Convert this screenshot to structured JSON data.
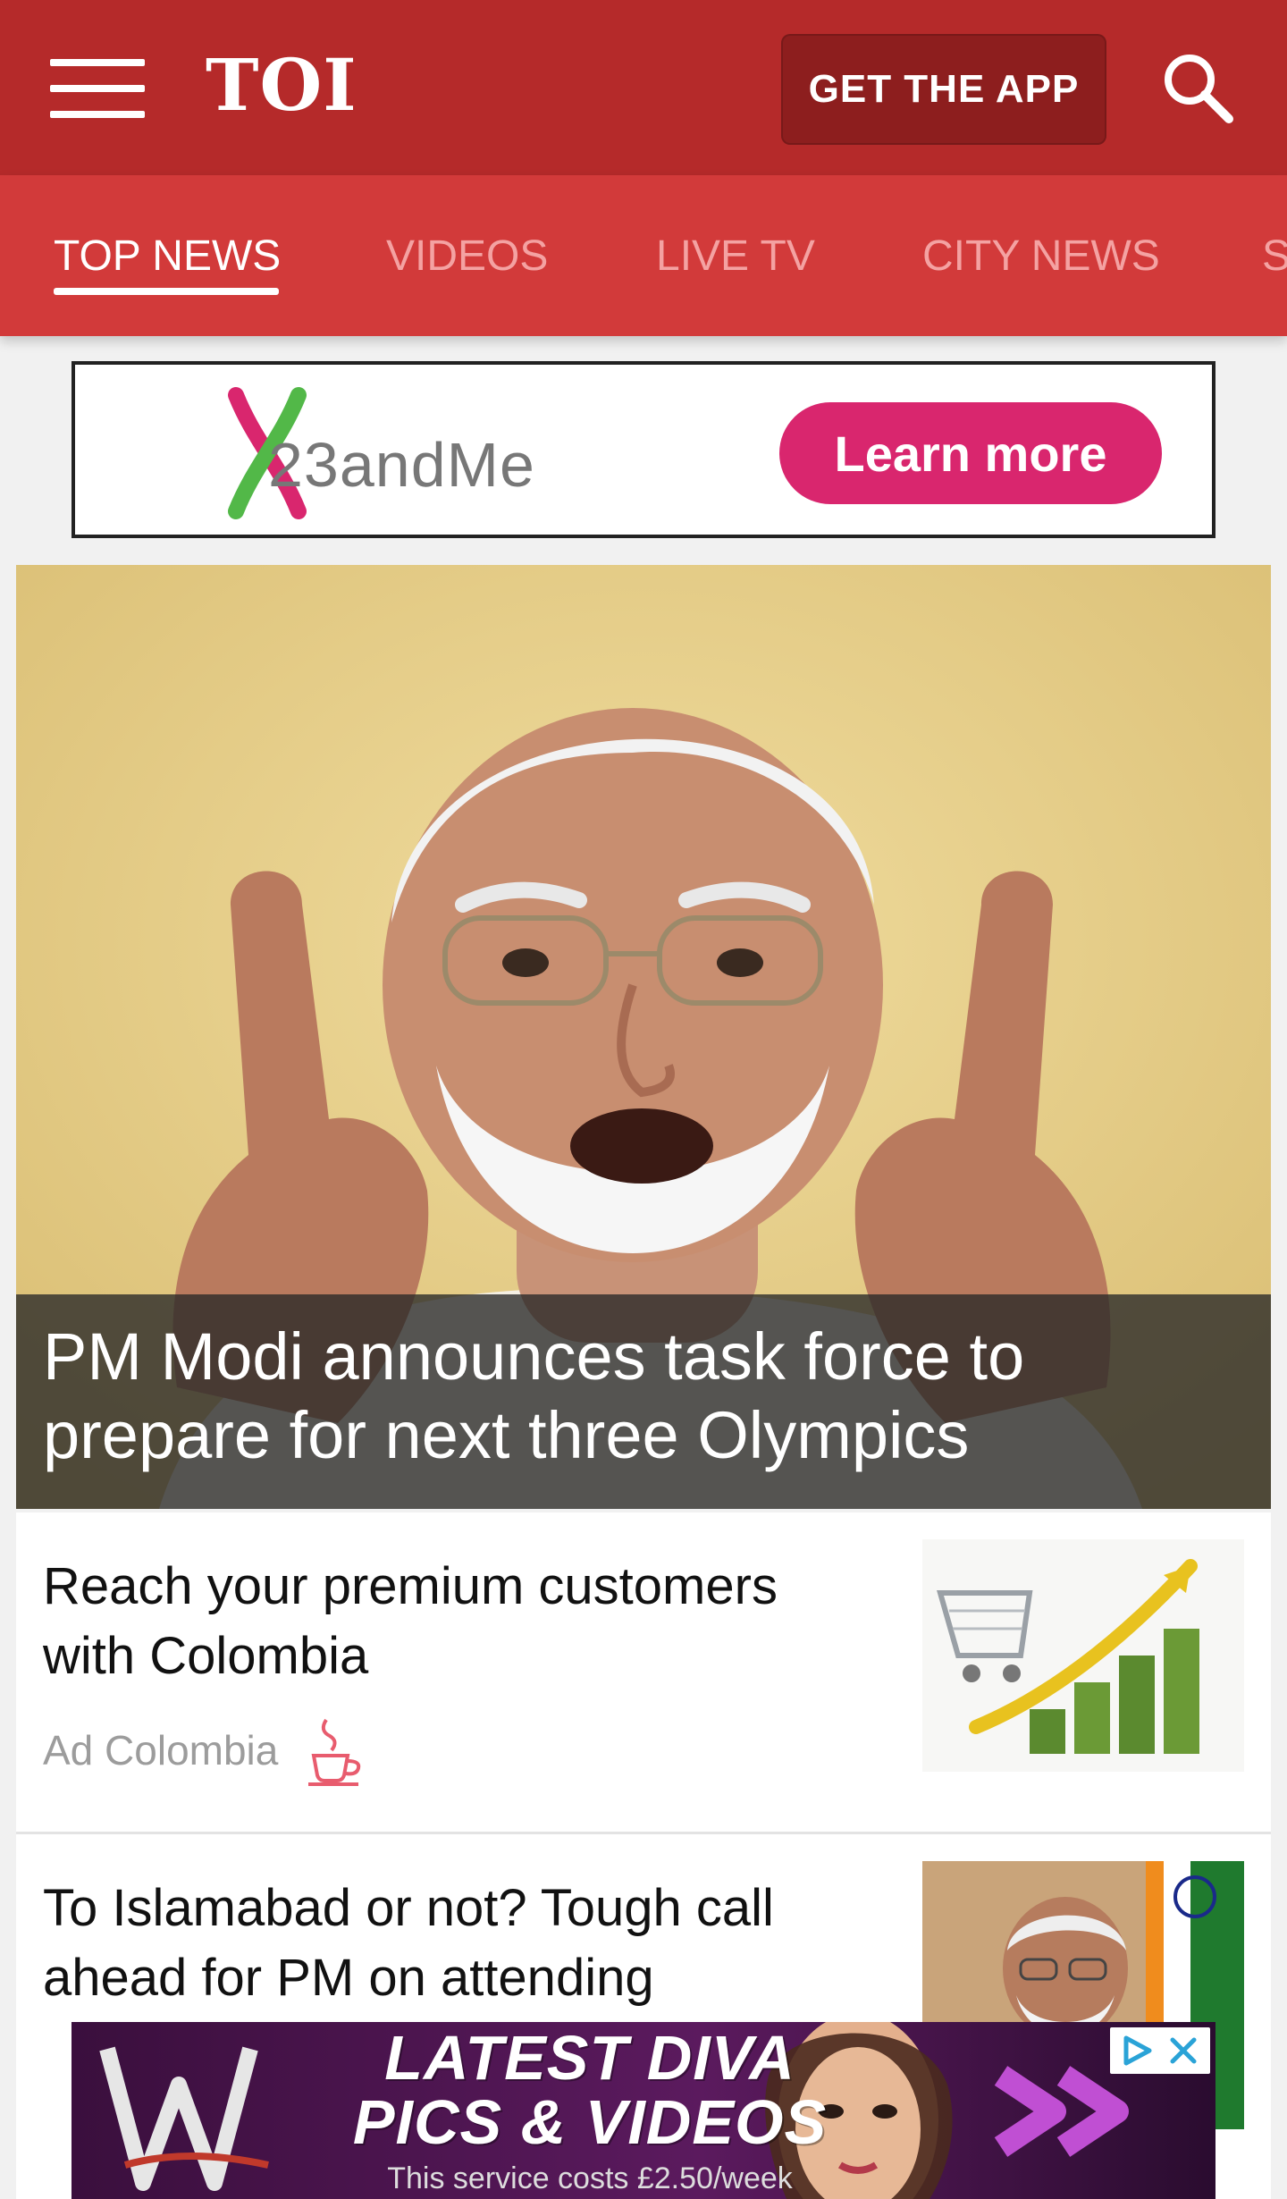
{
  "header": {
    "brand": "TOI",
    "get_app_label": "GET THE APP"
  },
  "nav": {
    "items": [
      {
        "label": "TOP NEWS",
        "active": true
      },
      {
        "label": "VIDEOS",
        "active": false
      },
      {
        "label": "LIVE TV",
        "active": false
      },
      {
        "label": "CITY NEWS",
        "active": false
      },
      {
        "label": "S",
        "active": false
      }
    ]
  },
  "top_ad": {
    "brand": "23andMe",
    "cta": "Learn more",
    "accent": "#d9266e"
  },
  "hero": {
    "title": "PM Modi announces task force to prepare for next three Olympics"
  },
  "feed": [
    {
      "title": "Reach your premium customers with Colombia",
      "meta": "Ad Colombia",
      "icon": "coffee-cup-icon"
    },
    {
      "title": "To Islamabad or not? Tough call ahead for PM on attending",
      "meta": "",
      "icon": "flag-icon"
    }
  ],
  "bottom_ad": {
    "headline_line1": "LATEST DIVA",
    "headline_line2": "PICS & VIDEOS",
    "fine_print": "This service costs £2.50/week"
  },
  "colors": {
    "header_red": "#b52a2a",
    "nav_red": "#d23a3a",
    "button_dark_red": "#8d1e1e"
  }
}
